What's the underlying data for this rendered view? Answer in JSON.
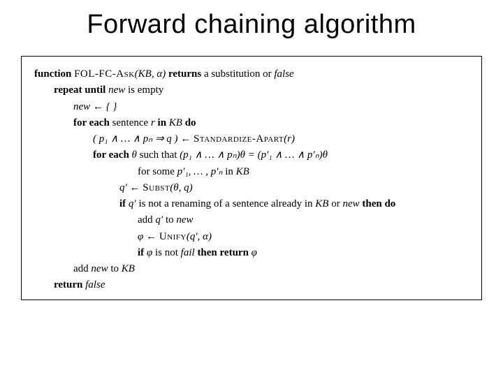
{
  "title": "Forward chaining algorithm",
  "algo": {
    "l1_a": "function",
    "l1_b": "FOL-FC-Ask",
    "l1_c": "(KB, α)",
    "l1_d": "returns",
    "l1_e": "a substitution or",
    "l1_f": "false",
    "l2_a": "repeat until",
    "l2_b": "new",
    "l2_c": "is empty",
    "l3_a": "new ← { }",
    "l4_a": "for each",
    "l4_b": "sentence",
    "l4_c": "r",
    "l4_d": "in",
    "l4_e": "KB",
    "l4_f": "do",
    "l5_a": "( p₁ ∧ … ∧ pₙ  ⇒  q ) ←",
    "l5_b": "Standardize-Apart",
    "l5_c": "(r)",
    "l6_a": "for each",
    "l6_b": "θ",
    "l6_c": "such that",
    "l6_d": "(p₁  ∧  …  ∧  pₙ)θ  =  (p′₁  ∧  …  ∧  p′ₙ)θ",
    "l7_a": "for some",
    "l7_b": "p′₁, … , p′ₙ",
    "l7_c": "in",
    "l7_d": "KB",
    "l8_a": "q′ ←",
    "l8_b": "Subst",
    "l8_c": "(θ, q)",
    "l9_a": "if",
    "l9_b": "q′",
    "l9_c": "is not a renaming of a sentence already in",
    "l9_d": "KB",
    "l9_e": "or",
    "l9_f": "new",
    "l9_g": "then do",
    "l10_a": "add",
    "l10_b": "q′",
    "l10_c": "to",
    "l10_d": "new",
    "l11_a": "φ ←",
    "l11_b": "Unify",
    "l11_c": "(q′, α)",
    "l12_a": "if",
    "l12_b": "φ",
    "l12_c": "is not",
    "l12_d": "fail",
    "l12_e": "then return",
    "l12_f": "φ",
    "l13_a": "add",
    "l13_b": "new",
    "l13_c": "to",
    "l13_d": "KB",
    "l14_a": "return",
    "l14_b": "false"
  }
}
